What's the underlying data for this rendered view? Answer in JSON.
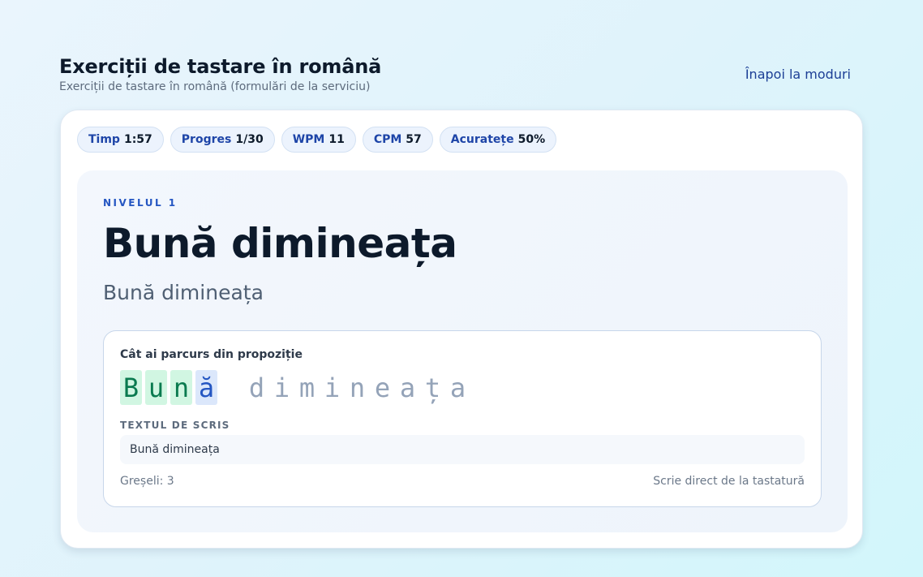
{
  "header": {
    "title": "Exerciții de tastare în română",
    "subtitle": "Exerciții de tastare în română (formulări de la serviciu)",
    "back_label": "Înapoi la moduri"
  },
  "stats": [
    {
      "label": "Timp",
      "value": "1:57"
    },
    {
      "label": "Progres",
      "value": "1/30"
    },
    {
      "label": "WPM",
      "value": "11"
    },
    {
      "label": "CPM",
      "value": "57"
    },
    {
      "label": "Acuratețe",
      "value": "50%"
    }
  ],
  "exercise": {
    "level": "NIVELUL 1",
    "word": "Bună dimineața",
    "translation": "Bună dimineața"
  },
  "practice": {
    "progress_label": "Cât ai parcurs din propoziție",
    "chars": [
      {
        "c": "B",
        "state": "correct"
      },
      {
        "c": "u",
        "state": "correct"
      },
      {
        "c": "n",
        "state": "correct"
      },
      {
        "c": "ă",
        "state": "current"
      },
      {
        "c": " ",
        "state": "pending"
      },
      {
        "c": "d",
        "state": "pending"
      },
      {
        "c": "i",
        "state": "pending"
      },
      {
        "c": "m",
        "state": "pending"
      },
      {
        "c": "i",
        "state": "pending"
      },
      {
        "c": "n",
        "state": "pending"
      },
      {
        "c": "e",
        "state": "pending"
      },
      {
        "c": "a",
        "state": "pending"
      },
      {
        "c": "ț",
        "state": "pending"
      },
      {
        "c": "a",
        "state": "pending"
      }
    ],
    "target_label": "TEXTUL DE SCRIS",
    "target_text": "Bună dimineața",
    "errors_text": "Greșeli: 3",
    "hint_text": "Scrie direct de la tastatură"
  },
  "colors": {
    "accent": "#2456c2",
    "correct_bg": "#d1f6e2",
    "correct_fg": "#0a7a4f",
    "current_bg": "#dbe7fb",
    "pending_fg": "#94a3b8"
  }
}
